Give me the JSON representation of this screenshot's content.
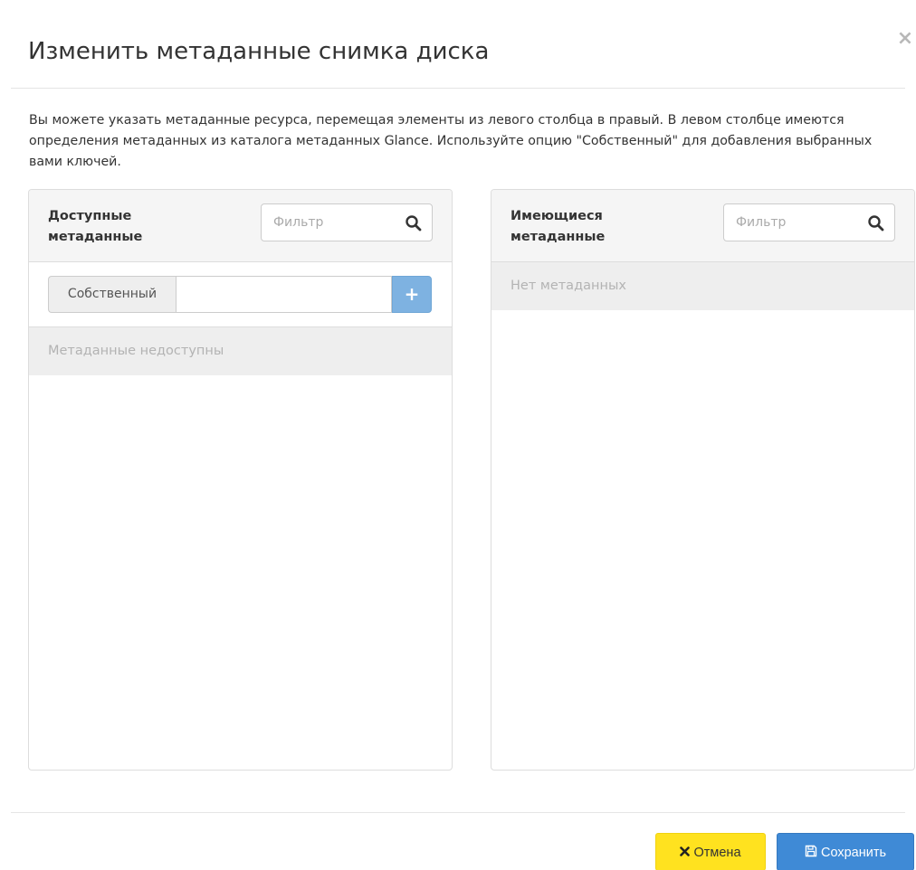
{
  "modal": {
    "title": "Изменить метаданные снимка диска",
    "close_icon": "×",
    "description": "Вы можете указать метаданные ресурса, перемещая элементы из левого столбца в правый. В левом столбце имеются определения метаданных из каталога метаданных Glance. Используйте опцию \"Собственный\" для добавления выбранных вами ключей."
  },
  "available": {
    "heading": "Доступные метаданные",
    "filter_placeholder": "Фильтр",
    "filter_value": "",
    "custom_label": "Собственный",
    "custom_value": "",
    "add_icon": "+",
    "empty_text": "Метаданные недоступны"
  },
  "existing": {
    "heading": "Имеющиеся метаданные",
    "filter_placeholder": "Фильтр",
    "filter_value": "",
    "empty_text": "Нет метаданных"
  },
  "footer": {
    "cancel_label": "Отмена",
    "save_label": "Сохранить"
  },
  "colors": {
    "cancel_bg": "#ffe21f",
    "save_bg": "#3f8ad6",
    "add_bg": "#7eb2e1"
  },
  "icons": {
    "close": "close-icon",
    "search": "search-icon",
    "add": "plus-icon",
    "cancel": "times-icon",
    "save": "floppy-disk-icon"
  }
}
